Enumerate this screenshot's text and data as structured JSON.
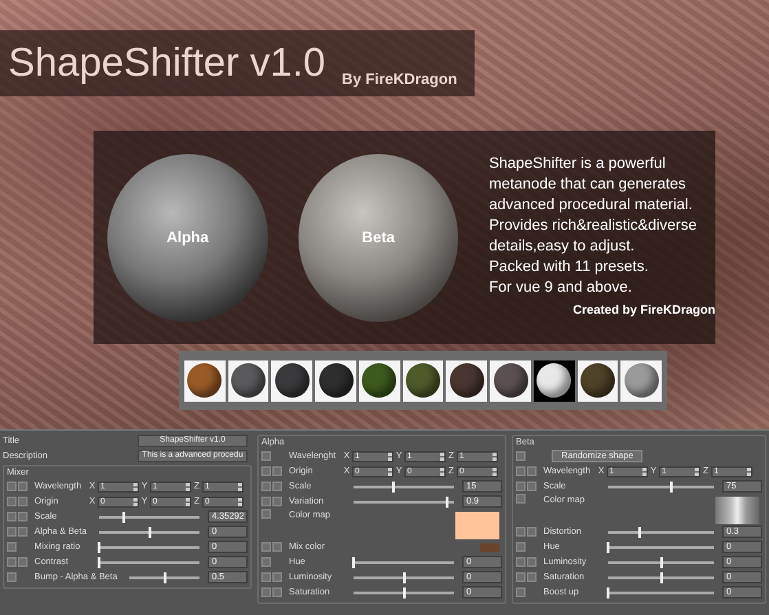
{
  "header": {
    "title": "ShapeShifter v1.0",
    "author": "By FireKDragon"
  },
  "preview": {
    "spheres": [
      {
        "label": "Alpha"
      },
      {
        "label": "Beta"
      }
    ],
    "description": [
      "ShapeShifter is a powerful metanode that can generates advanced procedural material.",
      "Provides rich&realistic&diverse details,easy to adjust.",
      "Packed with 11 presets.",
      "For vue 9 and above."
    ],
    "credit": "Created by FireKDragon"
  },
  "presets": [
    {
      "color": "#9a5a28",
      "selected": false
    },
    {
      "color": "#5a5a5c",
      "selected": false
    },
    {
      "color": "#3a3a3c",
      "selected": false
    },
    {
      "color": "#2e2e2e",
      "selected": false
    },
    {
      "color": "#3e5a1e",
      "selected": false
    },
    {
      "color": "#4e5a2a",
      "selected": false
    },
    {
      "color": "#4a3630",
      "selected": false
    },
    {
      "color": "#5a5050",
      "selected": false
    },
    {
      "color": "#e8e8e8",
      "selected": true
    },
    {
      "color": "#4e4228",
      "selected": false
    },
    {
      "color": "#9a9a9a",
      "selected": false
    }
  ],
  "settings": {
    "fields": [
      {
        "label": "Title",
        "value": "ShapeShifter v1.0"
      },
      {
        "label": "Description",
        "value": "This is a advanced procedu"
      }
    ],
    "groups": [
      {
        "title": "Mixer",
        "rows": [
          {
            "kind": "vector",
            "label": "Wavelength",
            "double_icon": true,
            "components": [
              {
                "axis": "X",
                "value": "1"
              },
              {
                "axis": "Y",
                "value": "1"
              },
              {
                "axis": "Z",
                "value": "1"
              }
            ]
          },
          {
            "kind": "vector",
            "label": "Origin",
            "double_icon": true,
            "components": [
              {
                "axis": "X",
                "value": "0"
              },
              {
                "axis": "Y",
                "value": "0"
              },
              {
                "axis": "Z",
                "value": "0"
              }
            ]
          },
          {
            "kind": "slider",
            "label": "Scale",
            "double_icon": true,
            "level": 0.24,
            "value": "4.35292"
          },
          {
            "kind": "slider",
            "label": "Alpha & Beta",
            "double_icon": true,
            "level": 0.5,
            "value": "0"
          },
          {
            "kind": "slider",
            "label": "Mixing ratio",
            "double_icon": false,
            "level": 0,
            "value": "0"
          },
          {
            "kind": "slider",
            "label": "Contrast",
            "double_icon": true,
            "level": 0,
            "value": "0"
          },
          {
            "kind": "slider",
            "label": "Bump - Alpha & Beta",
            "double_icon": false,
            "level": 0.5,
            "value": "0.5"
          }
        ]
      },
      {
        "title": "Alpha",
        "rows": [
          {
            "kind": "vector",
            "label": "Wavelenght",
            "double_icon": false,
            "components": [
              {
                "axis": "X",
                "value": "1"
              },
              {
                "axis": "Y",
                "value": "1"
              },
              {
                "axis": "Z",
                "value": "1"
              }
            ]
          },
          {
            "kind": "vector",
            "label": "Origin",
            "double_icon": true,
            "components": [
              {
                "axis": "X",
                "value": "0"
              },
              {
                "axis": "Y",
                "value": "0"
              },
              {
                "axis": "Z",
                "value": "0"
              }
            ]
          },
          {
            "kind": "slider",
            "label": "Scale",
            "double_icon": true,
            "level": 0.4,
            "value": "15"
          },
          {
            "kind": "slider",
            "label": "Variation",
            "double_icon": true,
            "level": 0.93,
            "value": "0.9"
          },
          {
            "kind": "color_map",
            "label": "Color map",
            "double_icon": false,
            "color": "#ffc49a"
          },
          {
            "kind": "color",
            "label": "Mix color",
            "double_icon": true,
            "color": "#6a4428"
          },
          {
            "kind": "slider",
            "label": "Hue",
            "double_icon": false,
            "level": 0,
            "value": "0"
          },
          {
            "kind": "slider",
            "label": "Luminosity",
            "double_icon": true,
            "level": 0.5,
            "value": "0"
          },
          {
            "kind": "slider",
            "label": "Saturation",
            "double_icon": true,
            "level": 0.5,
            "value": "0"
          }
        ]
      },
      {
        "title": "Beta",
        "rows": [
          {
            "kind": "button",
            "label": "Randomize shape",
            "double_icon": false
          },
          {
            "kind": "vector",
            "label": "Wavelength",
            "double_icon": true,
            "components": [
              {
                "axis": "X",
                "value": "1"
              },
              {
                "axis": "Y",
                "value": "1"
              },
              {
                "axis": "Z",
                "value": "1"
              }
            ]
          },
          {
            "kind": "slider",
            "label": "Scale",
            "double_icon": true,
            "level": 0.6,
            "value": "75"
          },
          {
            "kind": "gradient_map",
            "label": "Color map",
            "double_icon": false
          },
          {
            "kind": "slider",
            "label": "Distortion",
            "double_icon": true,
            "level": 0.3,
            "value": "0.3"
          },
          {
            "kind": "slider",
            "label": "Hue",
            "double_icon": false,
            "level": 0,
            "value": "0"
          },
          {
            "kind": "slider",
            "label": "Luminosity",
            "double_icon": true,
            "level": 0.5,
            "value": "0"
          },
          {
            "kind": "slider",
            "label": "Saturation",
            "double_icon": true,
            "level": 0.5,
            "value": "0"
          },
          {
            "kind": "slider",
            "label": "Boost up",
            "double_icon": false,
            "level": 0,
            "value": "0"
          }
        ]
      }
    ]
  }
}
